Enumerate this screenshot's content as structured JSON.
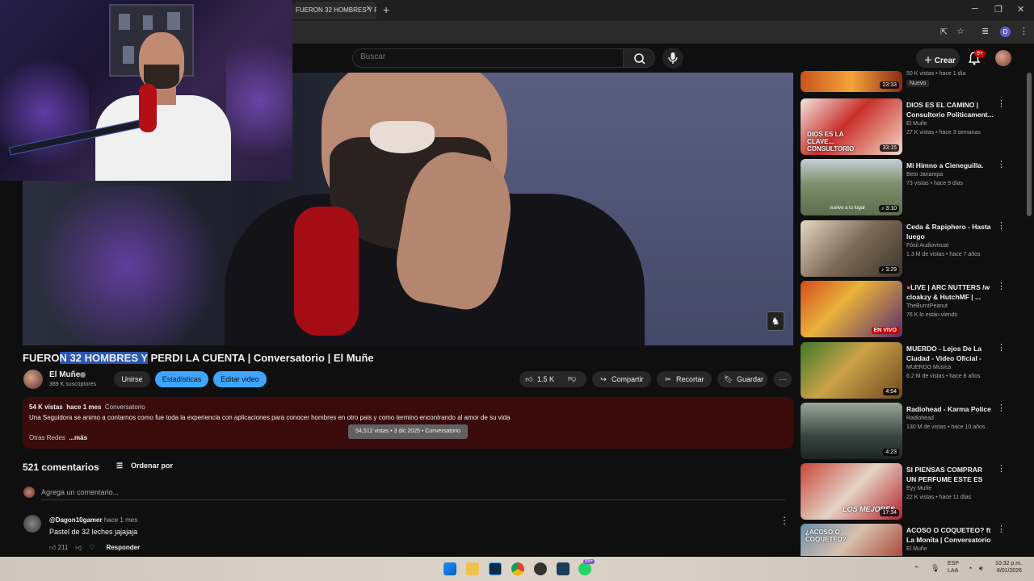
{
  "browser": {
    "tab_title": "FUERON 32 HOMBRES Y P",
    "tab_close": "×",
    "tab_new": "+",
    "profile_initial": "D"
  },
  "header": {
    "search_placeholder": "Buscar",
    "create_label": "Crear",
    "notif_count": "9+"
  },
  "video": {
    "title_pre": "FUERO",
    "title_hl": "N 32 HOMBRES Y",
    "title_post": " PERDI LA CUENTA | Conversatorio | El Muñe",
    "channel": "El Muñe",
    "subscribers": "389 K suscriptores",
    "join_label": "Unirse",
    "stats_label": "Estadísticas",
    "edit_label": "Editar video",
    "likes": "1.5 K",
    "share_label": "Compartir",
    "clip_label": "Recortar",
    "save_label": "Guardar"
  },
  "description": {
    "views": "54 K vistas",
    "date": "hace 1 mes",
    "tag": "Conversatorio",
    "text": "Una Seguidora se animo a contarnos como fue toda la experiencia con aplicaciones para conocer hombres en otro pais y como termino encontrando al amor de su vida",
    "more_prefix": "Otras Redes",
    "more_label": "...más",
    "tooltip": "54,512 vistas • 3 dic 2025 • Conversatorio"
  },
  "comments": {
    "count": "521 comentarios",
    "sort_label": "Ordenar por",
    "add_placeholder": "Agrega un comentario...",
    "items": [
      {
        "author": "@Dagon10gamer",
        "time": "hace 1 mes",
        "text": "Pastel de 32 leches jajajaja",
        "likes": "211",
        "reply_label": "Responder"
      }
    ]
  },
  "sidebar": {
    "items": [
      {
        "title": "",
        "channel": "",
        "meta": "50 K vistas • hace 1 día",
        "duration": "23:33",
        "badge": "Nuevo"
      },
      {
        "title": "DIOS ES EL CAMINO | Consultorio Politicament...",
        "channel": "El Muñe",
        "meta": "27 K vistas • hace 3 semanas",
        "duration": "33:15",
        "thumb_text": "DIOS ES LA CLAVE... CONSULTORIO"
      },
      {
        "title": "Mi Himno a Cieneguilla.",
        "channel": "Beto Janampa",
        "meta": "73 vistas • hace 9 días",
        "duration": "3:10",
        "thumb_text": "vuelvo a tu lugar"
      },
      {
        "title": "Ceda & Rapiphero - Hasta luego",
        "channel": "Fósil Audiovisual",
        "meta": "1.3 M de vistas • hace 7 años",
        "duration": "3:29"
      },
      {
        "title": "LIVE | ARC NUTTERS /w cloakzy & HutchMF | ...",
        "channel": "TheBurntPeanut",
        "meta": "76 K lo están viendo",
        "live": "EN VIVO"
      },
      {
        "title": "MUERDO - Lejos De La Ciudad - Video Oficial -",
        "channel": "MUERDO Música",
        "meta": "6.2 M de vistas • hace 8 años",
        "duration": "4:54"
      },
      {
        "title": "Radiohead - Karma Police",
        "channel": "Radiohead",
        "meta": "130 M de vistas • hace 10 años",
        "duration": "4:23"
      },
      {
        "title": "SI PIENSAS COMPRAR UN PERFUME ESTE ES TU ...",
        "channel": "Eyy Muñe",
        "meta": "22 K vistas • hace 11 días",
        "duration": "17:34",
        "thumb_text": "LOS MEJORES"
      },
      {
        "title": "ACOSO O COQUETEO? ft La Monita | Conversatorio | ...",
        "channel": "El Muñe",
        "meta": "",
        "thumb_text": "¿ACOSO O COQUETEO?"
      }
    ]
  },
  "taskbar": {
    "lang_top": "ESP",
    "lang_bottom": "LAA",
    "time": "10:32 p.m.",
    "date": "8/01/2026",
    "badge": "99+"
  },
  "colors": {
    "accent_blue": "#3ea6ff",
    "desc_bg": "#3a0b0b",
    "live_red": "#cc0000"
  }
}
